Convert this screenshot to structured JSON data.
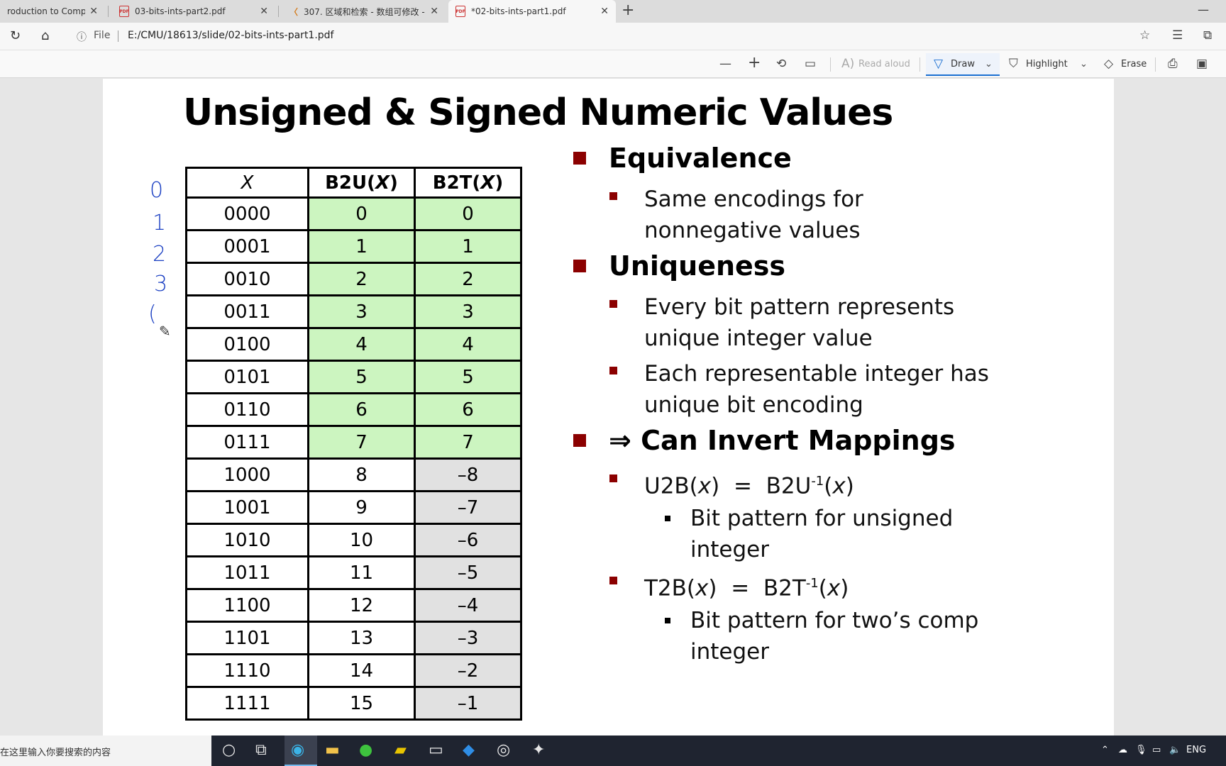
{
  "tabs": [
    {
      "title": "roduction to Compute",
      "icon": "page-icon"
    },
    {
      "title": "03-bits-ints-part2.pdf",
      "icon": "pdf-icon"
    },
    {
      "title": "307. 区域和检索 - 数组可修改 -",
      "icon": "leetcode-icon"
    },
    {
      "title": "*02-bits-ints-part1.pdf",
      "icon": "pdf-icon"
    }
  ],
  "address": {
    "scheme": "File",
    "url": "E:/CMU/18613/slide/02-bits-ints-part1.pdf"
  },
  "toolbar": {
    "read_aloud": "Read aloud",
    "draw": "Draw",
    "highlight": "Highlight",
    "erase": "Erase"
  },
  "slide": {
    "title": "Unsigned & Signed Numeric Values",
    "table": {
      "headers": [
        "X",
        "B2U(X)",
        "B2T(X)"
      ],
      "rows": [
        [
          "0000",
          "0",
          "0"
        ],
        [
          "0001",
          "1",
          "1"
        ],
        [
          "0010",
          "2",
          "2"
        ],
        [
          "0011",
          "3",
          "3"
        ],
        [
          "0100",
          "4",
          "4"
        ],
        [
          "0101",
          "5",
          "5"
        ],
        [
          "0110",
          "6",
          "6"
        ],
        [
          "0111",
          "7",
          "7"
        ],
        [
          "1000",
          "8",
          "–8"
        ],
        [
          "1001",
          "9",
          "–7"
        ],
        [
          "1010",
          "10",
          "–6"
        ],
        [
          "1011",
          "11",
          "–5"
        ],
        [
          "1100",
          "12",
          "–4"
        ],
        [
          "1101",
          "13",
          "–3"
        ],
        [
          "1110",
          "14",
          "–2"
        ],
        [
          "1111",
          "15",
          "–1"
        ]
      ]
    },
    "handwriting": [
      "0",
      "1",
      "2",
      "3",
      "("
    ],
    "equivalence": {
      "heading": "Equivalence",
      "items": [
        "Same encodings for nonnegative values"
      ]
    },
    "uniqueness": {
      "heading": "Uniqueness",
      "items": [
        "Every bit pattern represents unique integer value",
        "Each representable integer has unique bit encoding"
      ]
    },
    "invert": {
      "heading": "⇒ Can Invert Mappings",
      "u2b": "U2B(x)  =  B2U-1(x)",
      "u2b_sub": "Bit pattern for unsigned integer",
      "t2b": "T2B(x)  =  B2T-1(x)",
      "t2b_sub": "Bit pattern for two’s comp integer"
    }
  },
  "taskbar": {
    "search_placeholder": "在这里输入你要搜索的内容",
    "lang": "ENG"
  },
  "colors": {
    "green_cell": "#ccf5c0",
    "gray_cell": "#e1e1e1",
    "bullet": "#8b0000",
    "ink": "#1a3fc2"
  }
}
